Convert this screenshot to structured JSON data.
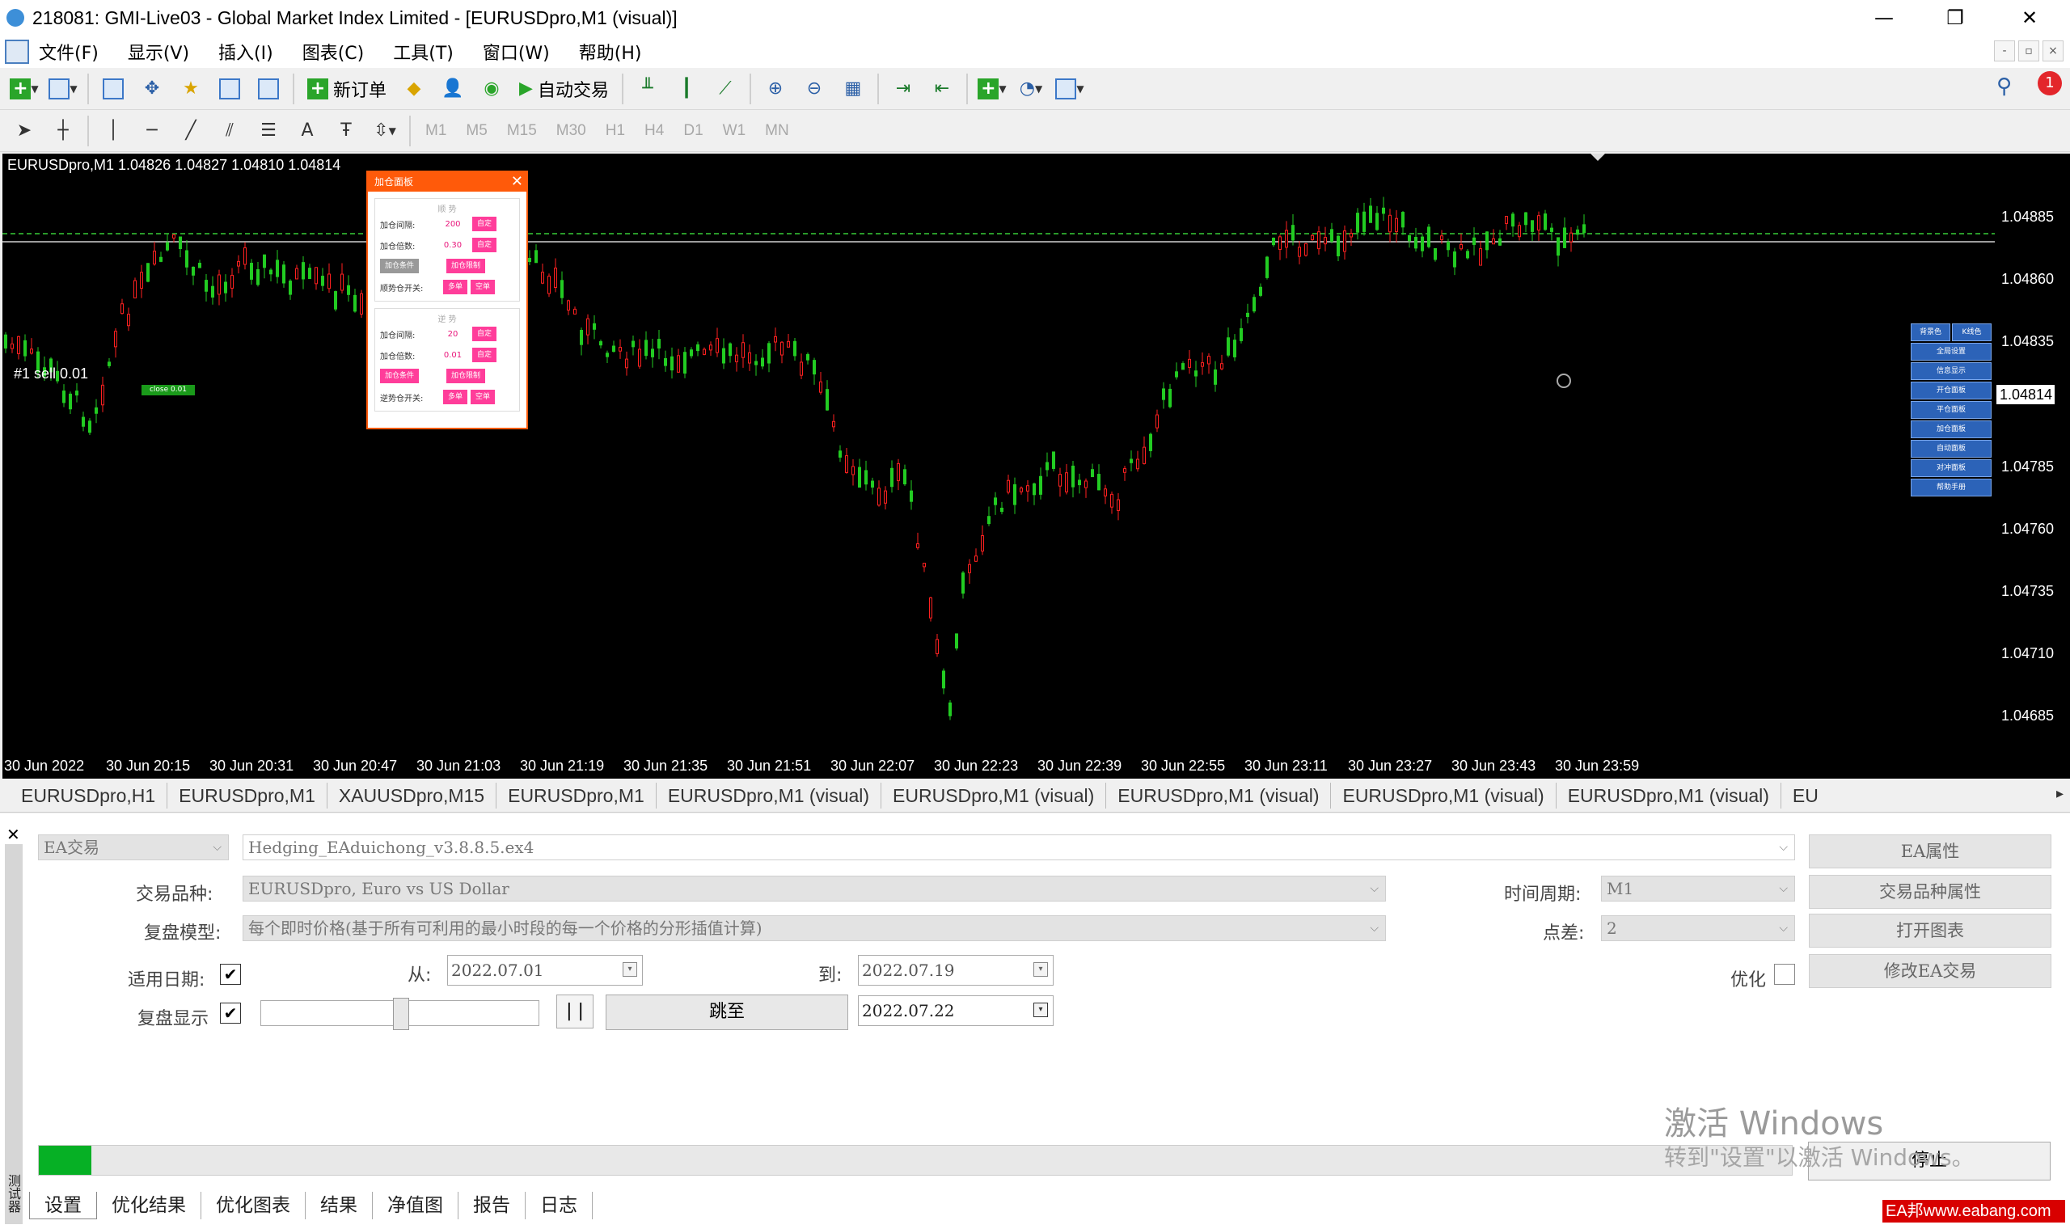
{
  "window": {
    "title": "218081: GMI-Live03 - Global Market Index Limited - [EURUSDpro,M1 (visual)]",
    "controls": {
      "minimize": "—",
      "maximize": "❐",
      "close": "✕"
    }
  },
  "menu": {
    "items": [
      "文件(F)",
      "显示(V)",
      "插入(I)",
      "图表(C)",
      "工具(T)",
      "窗口(W)",
      "帮助(H)"
    ]
  },
  "toolbar": {
    "new_order_label": "新订单",
    "auto_trade_label": "自动交易",
    "notification_count": "1",
    "timeframes": [
      "M1",
      "M5",
      "M15",
      "M30",
      "H1",
      "H4",
      "D1",
      "W1",
      "MN"
    ],
    "text_tool": "A"
  },
  "chart": {
    "info": "EURUSDpro,M1  1.04826 1.04827 1.04810 1.04814",
    "sell_label": "#1 sell 0.01",
    "close_tag": "close 0.01",
    "current_price": "1.04814",
    "bg_color": "#000000",
    "bull_color": "#ff2020",
    "bear_color": "#22cc22",
    "price_labels": [
      "1.04885",
      "1.04860",
      "1.04835",
      "1.04785",
      "1.04760",
      "1.04735",
      "1.04710",
      "1.04685"
    ],
    "time_labels": [
      "30 Jun 2022",
      "30 Jun 20:15",
      "30 Jun 20:31",
      "30 Jun 20:47",
      "30 Jun 21:03",
      "30 Jun 21:19",
      "30 Jun 21:35",
      "30 Jun 21:51",
      "30 Jun 22:07",
      "30 Jun 22:23",
      "30 Jun 22:39",
      "30 Jun 22:55",
      "30 Jun 23:11",
      "30 Jun 23:27",
      "30 Jun 23:43",
      "30 Jun 23:59"
    ]
  },
  "panel": {
    "title": "加仓面板",
    "section1_title": "顺 势",
    "section2_title": "逆 势",
    "rows1": [
      {
        "label": "加仓间隔:",
        "value": "200",
        "btn": "自定"
      },
      {
        "label": "加仓倍数:",
        "value": "0.30",
        "btn": "自定"
      }
    ],
    "cond1": {
      "btn1": "加仓条件",
      "btn2": "加仓限制"
    },
    "switch1": {
      "label": "顺势仓开关:",
      "btn1": "多单",
      "btn2": "空单"
    },
    "rows2": [
      {
        "label": "加仓间隔:",
        "value": "20",
        "btn": "自定"
      },
      {
        "label": "加仓倍数:",
        "value": "0.01",
        "btn": "自定"
      }
    ],
    "cond2": {
      "btn1": "加仓条件",
      "btn2": "加仓限制"
    },
    "switch2": {
      "label": "逆势仓开关:",
      "btn1": "多单",
      "btn2": "空单"
    }
  },
  "right_panel": {
    "top": [
      "背景色",
      "K线色"
    ],
    "items": [
      "全局设置",
      "信息显示",
      "开仓面板",
      "平仓面板",
      "加仓面板",
      "自动面板",
      "对冲面板",
      "帮助手册"
    ]
  },
  "chart_tabs": [
    "EURUSDpro,H1",
    "EURUSDpro,M1",
    "XAUUSDpro,M15",
    "EURUSDpro,M1",
    "EURUSDpro,M1 (visual)",
    "EURUSDpro,M1 (visual)",
    "EURUSDpro,M1 (visual)",
    "EURUSDpro,M1 (visual)",
    "EURUSDpro,M1 (visual)",
    "EU"
  ],
  "tester": {
    "close": "✕",
    "side_label": "测试器",
    "mode": "EA交易",
    "expert": "Hedging_EAduichong_v3.8.8.5.ex4",
    "symbol_label": "交易品种:",
    "symbol": "EURUSDpro, Euro vs US Dollar",
    "model_label": "复盘模型:",
    "model": "每个即时价格(基于所有可利用的最小时段的每一个价格的分形插值计算)",
    "use_date_label": "适用日期:",
    "use_date_checked": true,
    "from_label": "从:",
    "from": "2022.07.01",
    "to_label": "到:",
    "to": "2022.07.19",
    "visual_label": "复盘显示",
    "visual_checked": true,
    "visual_speed": 0.5,
    "pause": "| |",
    "jump": "跳至",
    "jump_date": "2022.07.22",
    "period_label": "时间周期:",
    "period": "M1",
    "spread_label": "点差:",
    "spread": "2",
    "optimize_label": "优化",
    "buttons": [
      "EA属性",
      "交易品种属性",
      "打开图表",
      "修改EA交易"
    ],
    "stop": "停止",
    "progress": 0.03
  },
  "watermark": {
    "line1": "激活 Windows",
    "line2": "转到\"设置\"以激活 Windows。"
  },
  "bottom_tabs": [
    "设置",
    "优化结果",
    "优化图表",
    "结果",
    "净值图",
    "报告",
    "日志"
  ],
  "site_badge": "EA邦www.eabang.com"
}
